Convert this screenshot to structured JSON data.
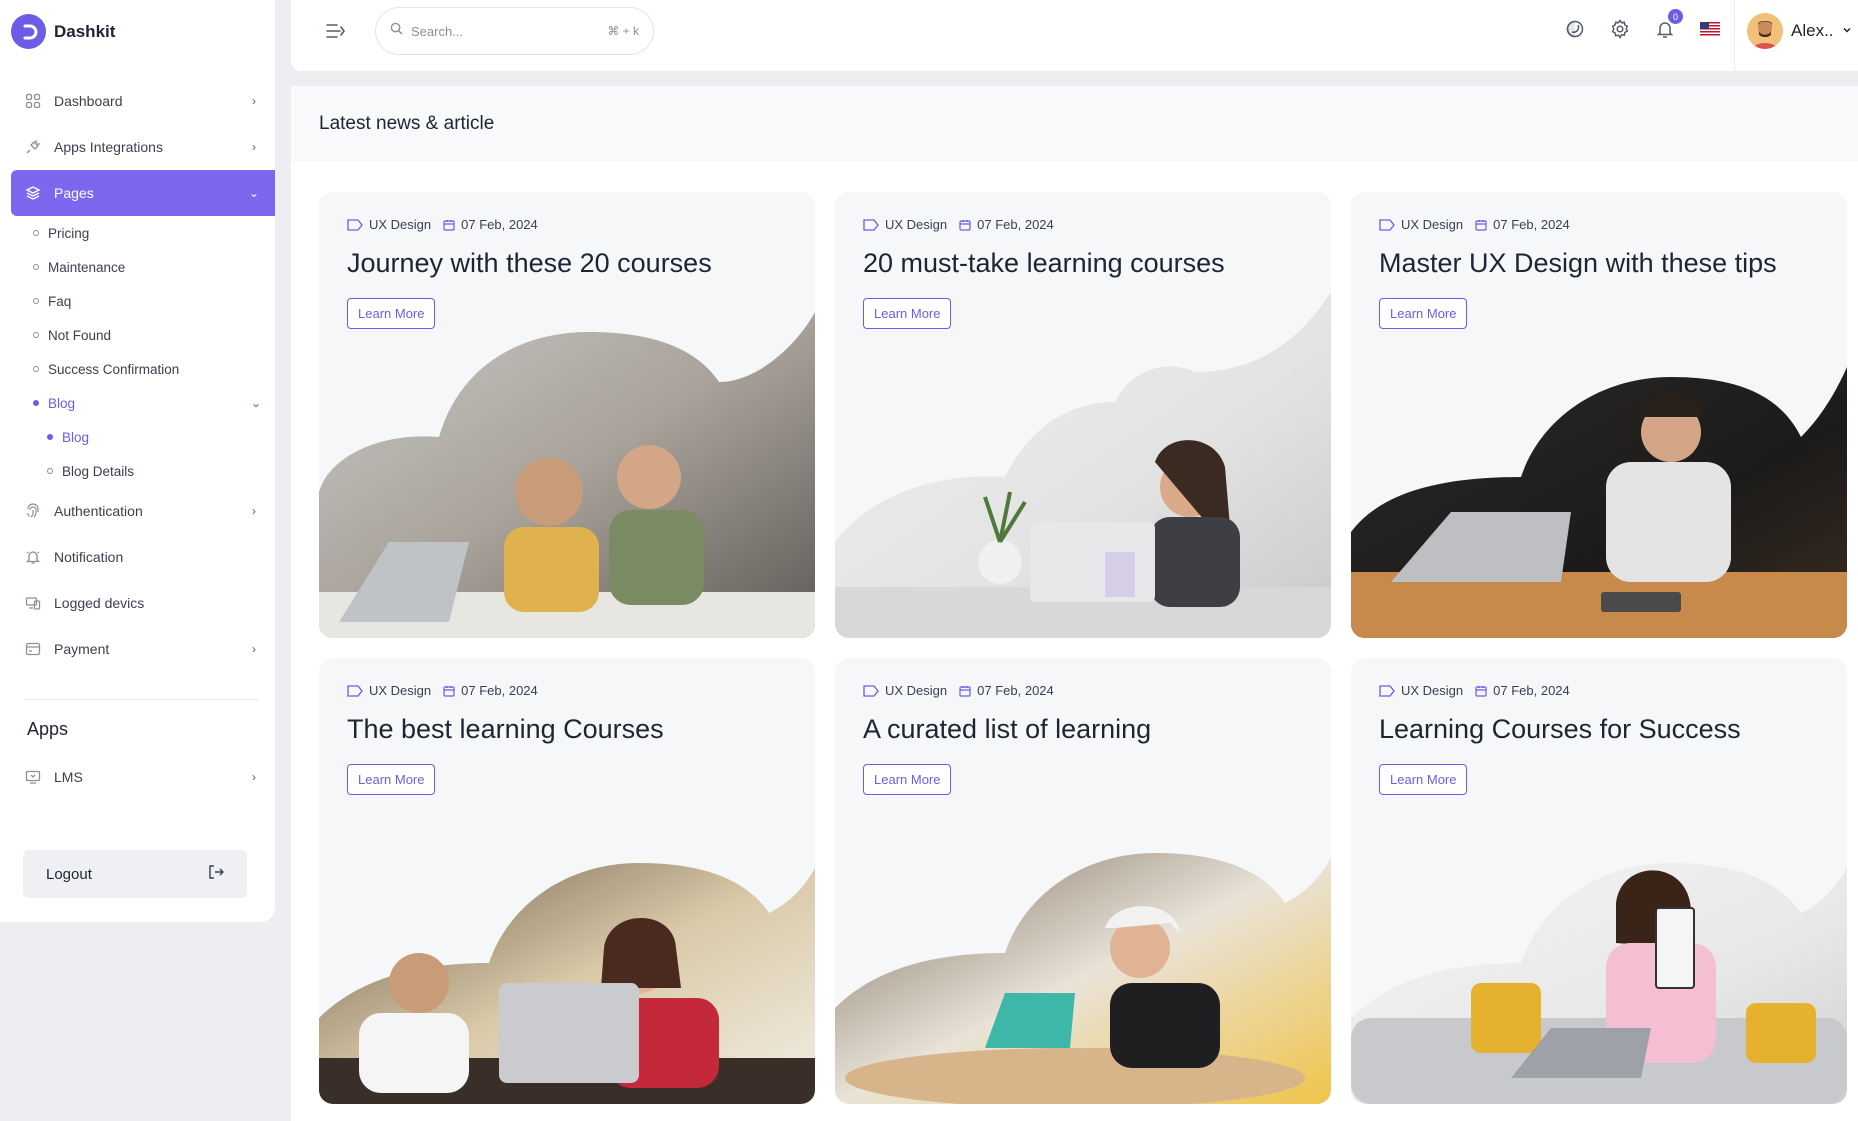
{
  "brand": {
    "name": "Dashkit"
  },
  "sidebar": {
    "items": [
      {
        "label": "Dashboard",
        "icon": "grid-icon",
        "chevron": "›"
      },
      {
        "label": "Apps Integrations",
        "icon": "plug-icon",
        "chevron": "›"
      },
      {
        "label": "Pages",
        "icon": "layers-icon",
        "chevron": "⌄",
        "active": true
      }
    ],
    "pages_sub": [
      "Pricing",
      "Maintenance",
      "Faq",
      "Not Found",
      "Success Confirmation"
    ],
    "blog": {
      "label": "Blog",
      "chevron": "⌄",
      "children": [
        "Blog",
        "Blog Details"
      ]
    },
    "items_after": [
      {
        "label": "Authentication",
        "icon": "fingerprint-icon",
        "chevron": "›"
      },
      {
        "label": "Notification",
        "icon": "bell-icon",
        "chevron": ""
      },
      {
        "label": "Logged devics",
        "icon": "devices-icon",
        "chevron": ""
      },
      {
        "label": "Payment",
        "icon": "card-icon",
        "chevron": "›"
      }
    ],
    "apps_title": "Apps",
    "lms": {
      "label": "LMS",
      "icon": "monitor-icon",
      "chevron": "›"
    },
    "logout": "Logout"
  },
  "header": {
    "search_placeholder": "Search...",
    "shortcut": "⌘ + k",
    "notification_count": "0",
    "user_name": "Alex.."
  },
  "page": {
    "title": "Latest news & article"
  },
  "cards": [
    {
      "category": "UX Design",
      "date": "07 Feb, 2024",
      "title": "Journey with these 20 courses",
      "cta": "Learn More"
    },
    {
      "category": "UX Design",
      "date": "07 Feb, 2024",
      "title": "20 must-take learning courses",
      "cta": "Learn More"
    },
    {
      "category": "UX Design",
      "date": "07 Feb, 2024",
      "title": "Master UX Design with these tips",
      "cta": "Learn More"
    },
    {
      "category": "UX Design",
      "date": "07 Feb, 2024",
      "title": "The best learning Courses",
      "cta": "Learn More"
    },
    {
      "category": "UX Design",
      "date": "07 Feb, 2024",
      "title": "A curated list of learning",
      "cta": "Learn More"
    },
    {
      "category": "UX Design",
      "date": "07 Feb, 2024",
      "title": "Learning Courses for Success",
      "cta": "Learn More"
    }
  ],
  "colors": {
    "accent": "#7b68ee",
    "brand": "#6c5ce7"
  }
}
